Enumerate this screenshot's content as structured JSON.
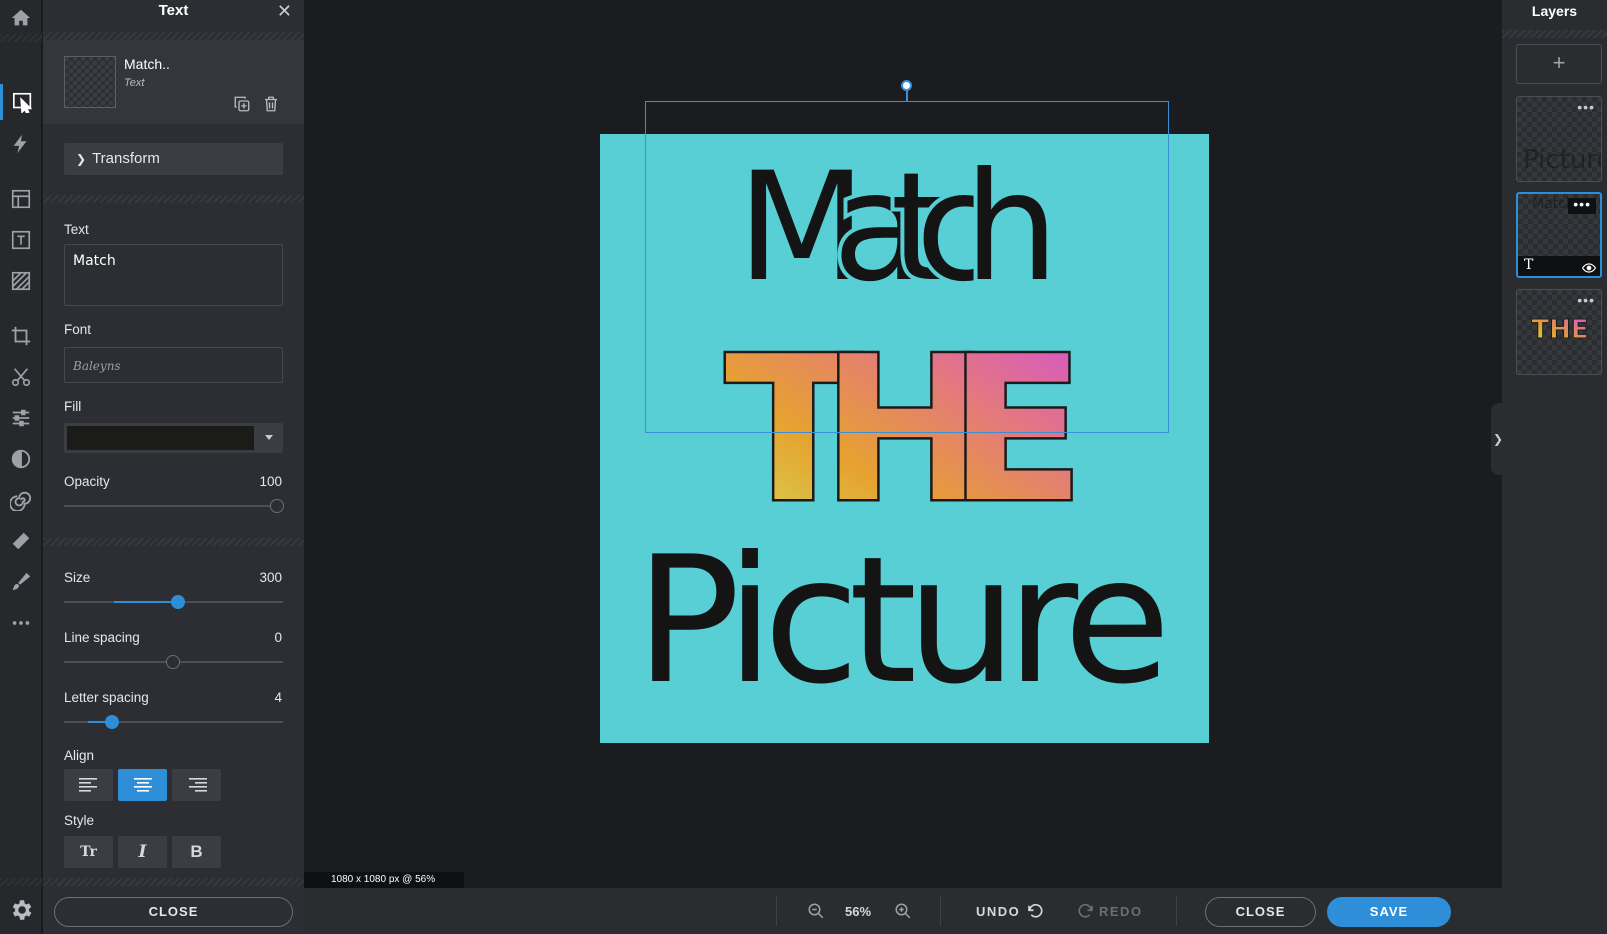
{
  "text_panel": {
    "title": "Text",
    "close_symbol": "✕",
    "layer_name": "Match..",
    "layer_type": "Text",
    "transform_label": "Transform",
    "text_label": "Text",
    "text_value": "Match",
    "font_label": "Font",
    "font_value": "Baleyns",
    "fill_label": "Fill",
    "fill_color": "#1b1b18",
    "opacity_label": "Opacity",
    "opacity_value": "100",
    "size_label": "Size",
    "size_value": "300",
    "line_spacing_label": "Line spacing",
    "line_spacing_value": "0",
    "letter_spacing_label": "Letter spacing",
    "letter_spacing_value": "4",
    "align_label": "Align",
    "align_selected": "center",
    "style_label": "Style",
    "style_buttons": [
      "Tr",
      "I",
      "B"
    ],
    "close_label": "CLOSE"
  },
  "canvas": {
    "size_info": "1080 x 1080 px @ 56%",
    "background_color": "#57cfd4",
    "text_line1": "Match",
    "text_line2": "THE",
    "text_line3": "Picture"
  },
  "bottom_bar": {
    "zoom": "56%",
    "undo_label": "UNDO",
    "redo_label": "REDO",
    "close_label": "CLOSE",
    "save_label": "SAVE"
  },
  "layers_panel": {
    "title": "Layers",
    "add_symbol": "+",
    "layers": [
      {
        "preview_text": "Picture",
        "selected": false
      },
      {
        "preview_text": "Match",
        "selected": true
      },
      {
        "preview_text": "THE",
        "selected": false
      }
    ]
  },
  "tools": [
    "home-icon",
    "select-icon",
    "quick-actions-icon",
    "templates-icon",
    "text-icon",
    "texture-icon",
    "crop-icon",
    "cutout-icon",
    "adjust-icon",
    "filters-icon",
    "effects-icon",
    "retouch-icon",
    "draw-icon",
    "more-icon",
    "settings-icon"
  ],
  "colors": {
    "accent": "#2f8ed8",
    "panel": "#2c2e33",
    "canvas_bg": "#1b1c1f"
  }
}
